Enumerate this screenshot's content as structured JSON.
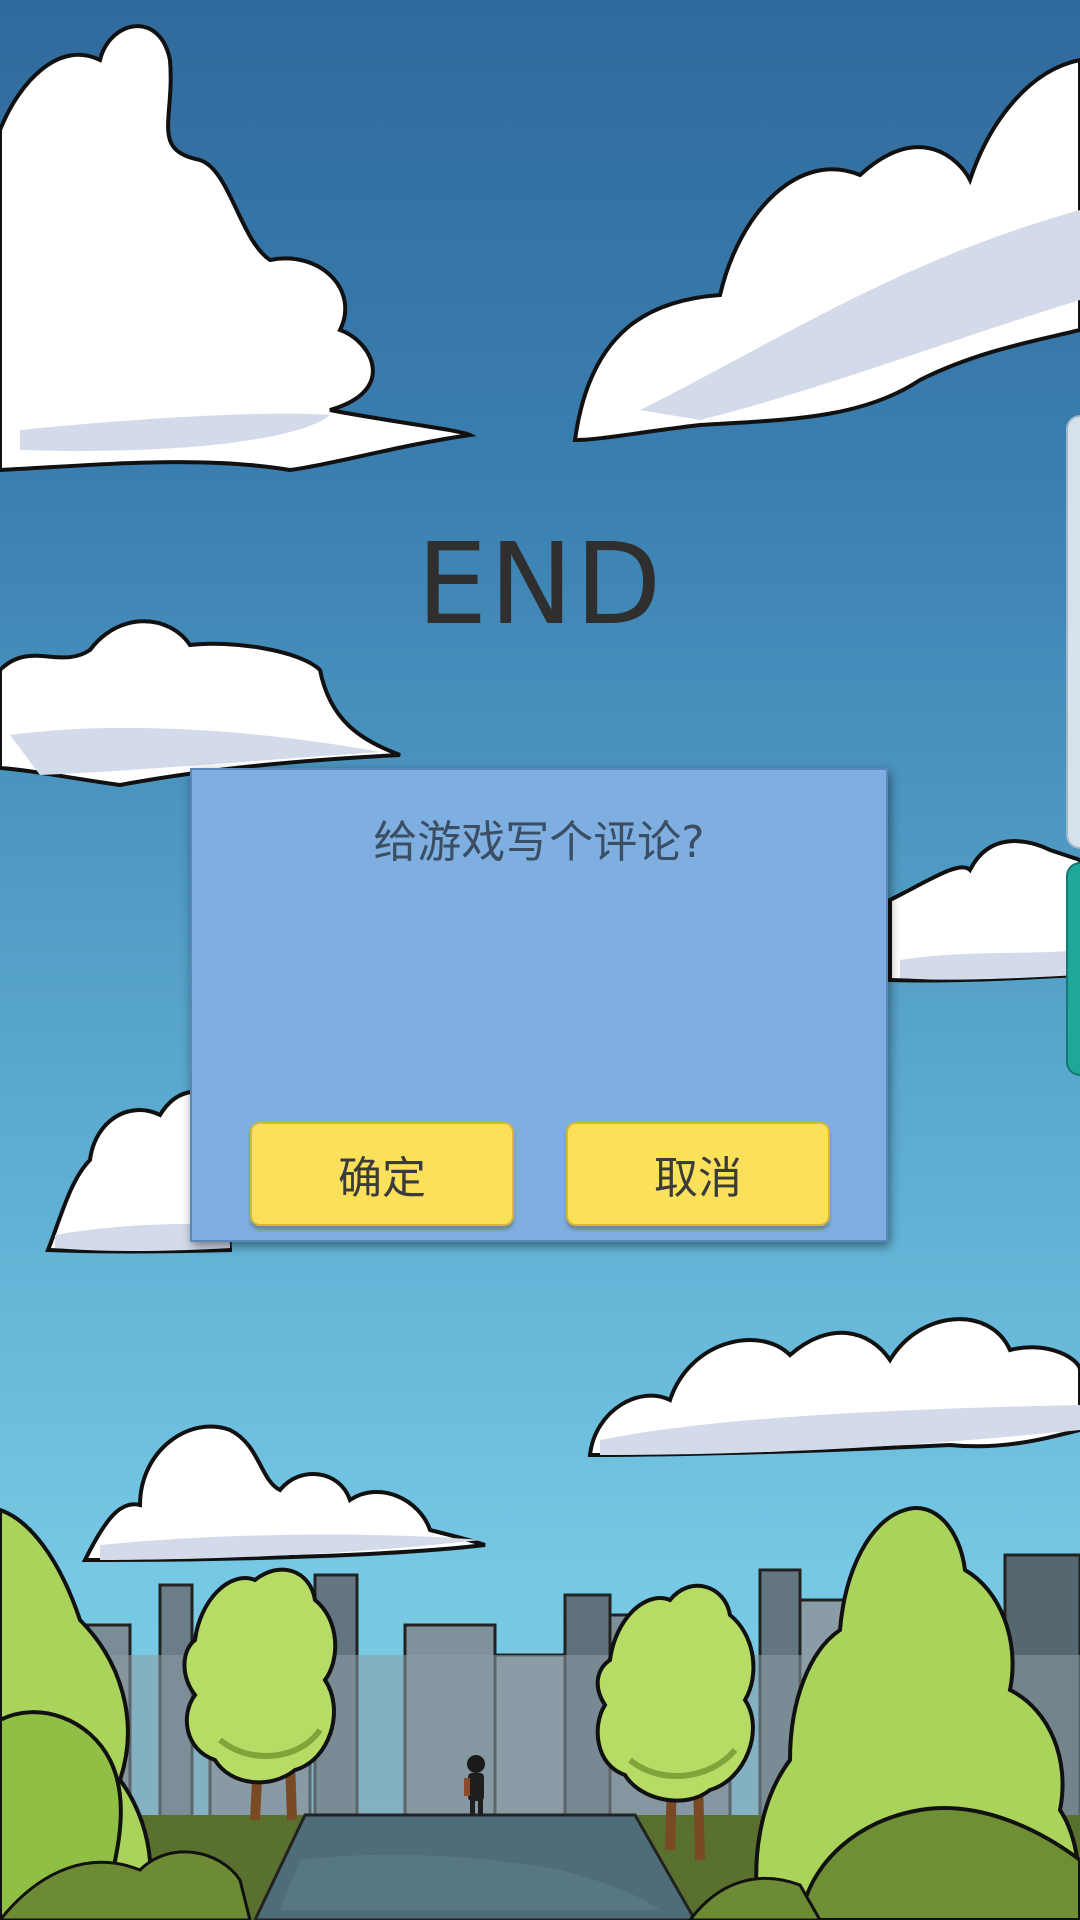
{
  "screen": {
    "title": "END"
  },
  "dialog": {
    "message": "给游戏写个评论?",
    "confirm_label": "确定",
    "cancel_label": "取消"
  },
  "colors": {
    "sky_top": "#316a9c",
    "sky_bottom": "#7ccde6",
    "dialog_bg": "#7eafe0",
    "button_bg": "#fbe05a",
    "cloud": "#ffffff",
    "tree": "#a9d35a"
  }
}
